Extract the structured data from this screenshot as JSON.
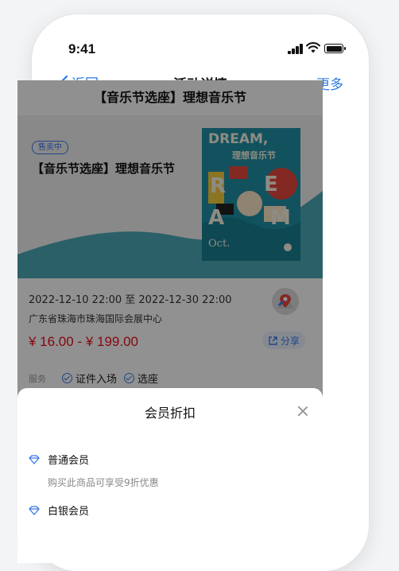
{
  "status_bar": {
    "time": "9:41"
  },
  "nav": {
    "back_label": "返回",
    "title": "活动详情",
    "more_label": "更多"
  },
  "event": {
    "header_title": "【音乐节选座】理想音乐节",
    "status_badge": "售卖中",
    "banner_title": "【音乐节选座】理想音乐节",
    "poster": {
      "line1": "DREAM,",
      "line2": "理想音乐节",
      "letters": [
        "D",
        "R",
        "E",
        "A",
        "M"
      ],
      "month": "Oct."
    },
    "datetime": "2022-12-10 22:00 至 2022-12-30 22:00",
    "address": "广东省珠海市珠海国际会展中心",
    "price_range": "¥ 16.00 - ¥ 199.00",
    "share_label": "分享",
    "services_label": "服务",
    "services": [
      "证件入场",
      "选座"
    ]
  },
  "sheet": {
    "title": "会员折扣",
    "tiers": [
      {
        "name": "普通会员",
        "description": "购买此商品可享受9折优惠"
      },
      {
        "name": "白银会员",
        "description": ""
      }
    ]
  },
  "colors": {
    "accent": "#2a7be4",
    "price": "#e60f1e",
    "poster_teal": "#1f8ea3"
  },
  "icons": [
    "back-chevron-icon",
    "map-pin-icon",
    "share-icon",
    "check-circle-icon",
    "diamond-icon",
    "close-icon"
  ]
}
